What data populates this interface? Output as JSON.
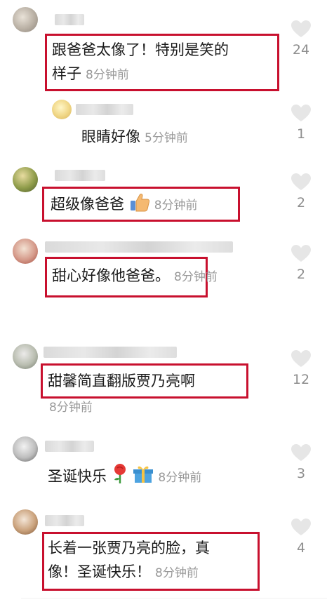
{
  "comments": [
    {
      "text": "跟爸爸太像了！特别是笑的",
      "text2": "样子",
      "time": "8分钟前",
      "likes": "24"
    },
    {
      "text": "眼睛好像",
      "time": "5分钟前",
      "likes": "1"
    },
    {
      "text": "超级像爸爸",
      "time": "8分钟前",
      "likes": "2"
    },
    {
      "text": "甜心好像他爸爸。",
      "time": "8分钟前",
      "likes": "2"
    },
    {
      "text": "甜馨简直翻版贾乃亮啊",
      "time": "8分钟前",
      "likes": "12"
    },
    {
      "text": "圣诞快乐",
      "time": "8分钟前",
      "likes": "3"
    },
    {
      "text": "长着一张贾乃亮的脸，真",
      "text2": "像！圣诞快乐！",
      "time": "8分钟前",
      "likes": "4"
    }
  ],
  "colors": {
    "highlight": "#c8102e",
    "timestamp": "#999999",
    "heart": "#e6e6e6"
  },
  "icons": {
    "like": "heart-icon",
    "thumbs_up": "thumbs-up-emoji",
    "rose": "rose-emoji",
    "gift": "gift-emoji"
  }
}
